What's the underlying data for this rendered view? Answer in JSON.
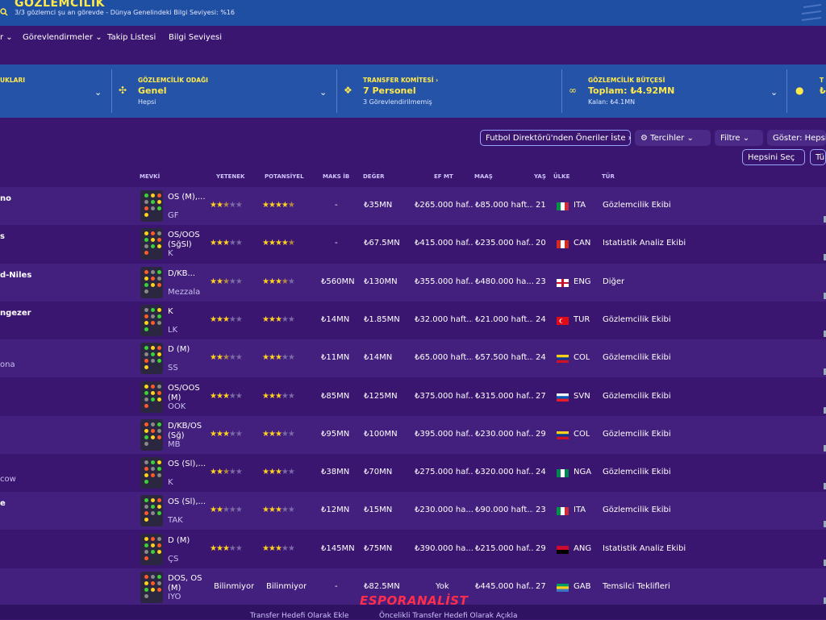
{
  "header": {
    "title": "GÖZLEMCİLİK",
    "subtitle": "3/3 gözlemci şu an görevde - Dünya Genelindeki Bilgi Seviyesi: %16"
  },
  "nav": {
    "items": [
      {
        "label": "r"
      },
      {
        "label": "Görevlendirmeler"
      },
      {
        "label": "Takip Listesi"
      },
      {
        "label": "Bilgi Seviyesi"
      }
    ]
  },
  "filters": {
    "f0": {
      "label": "UKLARI"
    },
    "f1": {
      "label": "GÖZLEMCİLİK ODAĞI",
      "value": "Genel",
      "hint": "Hepsi"
    },
    "f2": {
      "label": "TRANSFER KOMİTESİ ›",
      "value": "7 Personel",
      "hint": "3 Görevlendirilmemiş"
    },
    "f3": {
      "label": "GÖZLEMCİLİK BÜTÇESİ",
      "value": "Toplam: ₺4.92MN",
      "hint": "Kalan: ₺4.1MN"
    },
    "f4": {
      "label": "T",
      "value": "₺"
    }
  },
  "toolbar": {
    "df_suggest": "Futbol Direktörü'nden Öneriler İste",
    "prefs": "Tercihler",
    "filter": "Filtre",
    "show": "Göster: Hepsi",
    "select_all": "Hepsini Seç",
    "tu": "Tü"
  },
  "table": {
    "headers": {
      "mevki": "MEVKİ",
      "yetenek": "YETENEK",
      "potansiyel": "POTANSİYEL",
      "maksib": "MAKS İB",
      "deger": "DEĞER",
      "efmt": "EF MT",
      "maas": "MAAŞ",
      "yas": "YAŞ",
      "ulke": "ÜLKE",
      "tur": "TÜR"
    },
    "rows": [
      {
        "name": "no",
        "sub": "",
        "pos": "OS (M),...",
        "role": "GF",
        "ab": 2.5,
        "pa": 4.5,
        "maks": "-",
        "deger": "₺35MN",
        "efmt": "₺265.000 haf...",
        "maas": "₺85.000 haft...",
        "yas": "21",
        "ulke": "ITA",
        "tur": "Gözlemcilik Ekibi"
      },
      {
        "name": "s",
        "sub": "",
        "pos": "OS/OOS (SğSl)",
        "role": "K",
        "ab": 3,
        "pa": 4.5,
        "maks": "-",
        "deger": "₺67.5MN",
        "efmt": "₺415.000 haf...",
        "maas": "₺235.000 haf...",
        "yas": "20",
        "ulke": "CAN",
        "tur": "İstatistik Analiz Ekibi"
      },
      {
        "name": "d-Niles",
        "sub": "",
        "pos": "D/KB...",
        "role": "Mezzala",
        "ab": 2.5,
        "pa": 3.5,
        "maks": "₺560MN",
        "deger": "₺130MN",
        "efmt": "₺355.000 haf...",
        "maas": "₺480.000 ha...",
        "yas": "23",
        "ulke": "ENG",
        "tur": "Diğer"
      },
      {
        "name": "ngezer",
        "sub": "",
        "pos": "K",
        "role": "LK",
        "ab": 3,
        "pa": 3,
        "maks": "₺14MN",
        "deger": "₺1.85MN",
        "efmt": "₺32.000 haft...",
        "maas": "₺21.000 haft...",
        "yas": "24",
        "ulke": "TUR",
        "tur": "Gözlemcilik Ekibi"
      },
      {
        "name": "",
        "sub": "ona",
        "pos": "D (M)",
        "role": "SS",
        "ab": 2.5,
        "pa": 3,
        "maks": "₺11MN",
        "deger": "₺14MN",
        "efmt": "₺65.000 haft...",
        "maas": "₺57.500 haft...",
        "yas": "24",
        "ulke": "COL",
        "tur": "Gözlemcilik Ekibi"
      },
      {
        "name": "",
        "sub": "",
        "pos": "OS/OOS (M)",
        "role": "OOK",
        "ab": 3,
        "pa": 3,
        "maks": "₺85MN",
        "deger": "₺125MN",
        "efmt": "₺375.000 haf...",
        "maas": "₺315.000 haf...",
        "yas": "27",
        "ulke": "SVN",
        "tur": "Gözlemcilik Ekibi"
      },
      {
        "name": "",
        "sub": "",
        "pos": "D/KB/OS (Sğ)",
        "role": "MB",
        "ab": 3,
        "pa": 3,
        "maks": "₺95MN",
        "deger": "₺100MN",
        "efmt": "₺395.000 haf...",
        "maas": "₺230.000 haf...",
        "yas": "29",
        "ulke": "COL",
        "tur": "Gözlemcilik Ekibi"
      },
      {
        "name": "",
        "sub": "cow",
        "pos": "OS (Sl),...",
        "role": "K",
        "ab": 2.5,
        "pa": 3,
        "maks": "₺38MN",
        "deger": "₺70MN",
        "efmt": "₺275.000 haf...",
        "maas": "₺320.000 haf...",
        "yas": "24",
        "ulke": "NGA",
        "tur": "Gözlemcilik Ekibi"
      },
      {
        "name": "e",
        "sub": "",
        "pos": "OS (Sl),...",
        "role": "TAK",
        "ab": 2,
        "pa": 3,
        "maks": "₺12MN",
        "deger": "₺15MN",
        "efmt": "₺230.000 ha...",
        "maas": "₺90.000 haft...",
        "yas": "23",
        "ulke": "ITA",
        "tur": "Gözlemcilik Ekibi"
      },
      {
        "name": "",
        "sub": "",
        "pos": "D (M)",
        "role": "ÇS",
        "ab": 3,
        "pa": 3,
        "maks": "₺145MN",
        "deger": "₺75MN",
        "efmt": "₺390.000 ha...",
        "maas": "₺215.000 haf...",
        "yas": "29",
        "ulke": "ANG",
        "tur": "İstatistik Analiz Ekibi"
      },
      {
        "name": "",
        "sub": "",
        "pos": "DOS, OS (M)",
        "role": "İYO",
        "abText": "Bilinmiyor",
        "paText": "Bilinmiyor",
        "maks": "-",
        "deger": "₺82.5MN",
        "efmt": "Yok",
        "maas": "₺445.000 haf...",
        "yas": "27",
        "ulke": "GAB",
        "tur": "Temsilci Teklifleri"
      }
    ]
  },
  "footer": {
    "a": "Transfer Hedefi Olarak Ekle",
    "b": "Öncelikli Transfer Hedefi Olarak Açıkla"
  },
  "watermark": {
    "a": "ESPOR",
    "b": "ANALİST"
  },
  "colors": {
    "accent_yellow": "#ffe94a",
    "header_blue": "#1f4fa3",
    "bg_purple": "#3a1670"
  }
}
